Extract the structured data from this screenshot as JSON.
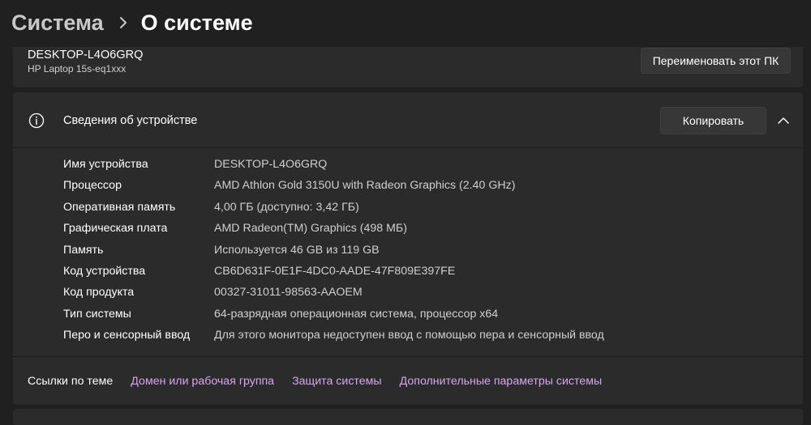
{
  "breadcrumb": {
    "parent": "Система",
    "separator": ">",
    "current": "О системе"
  },
  "device": {
    "name": "DESKTOP-L4O6GRQ",
    "model": "HP Laptop 15s-eq1xxx",
    "rename_button": "Переименовать этот ПК"
  },
  "specs": {
    "icon": "info-icon",
    "title": "Сведения об устройстве",
    "copy_button": "Копировать",
    "rows": [
      {
        "label": "Имя устройства",
        "value": "DESKTOP-L4O6GRQ"
      },
      {
        "label": "Процессор",
        "value": "AMD Athlon Gold 3150U with Radeon Graphics (2.40 GHz)"
      },
      {
        "label": "Оперативная память",
        "value": "4,00 ГБ (доступно: 3,42 ГБ)"
      },
      {
        "label": "Графическая плата",
        "value": "AMD Radeon(TM) Graphics (498 МБ)"
      },
      {
        "label": "Память",
        "value": "Используется 46 GB из 119 GB"
      },
      {
        "label": "Код устройства",
        "value": "CB6D631F-0E1F-4DC0-AADE-47F809E397FE"
      },
      {
        "label": "Код продукта",
        "value": "00327-31011-98563-AAOEM"
      },
      {
        "label": "Тип системы",
        "value": "64-разрядная операционная система, процессор x64"
      },
      {
        "label": "Перо и сенсорный ввод",
        "value": "Для этого монитора недоступен ввод с помощью пера и сенсорный ввод"
      }
    ]
  },
  "related_links": {
    "title": "Ссылки по теме",
    "links": [
      "Домен или рабочая группа",
      "Защита системы",
      "Дополнительные параметры системы"
    ]
  },
  "colors": {
    "background": "#202020",
    "card": "#2b2b2b",
    "link": "#d5a6f0"
  }
}
